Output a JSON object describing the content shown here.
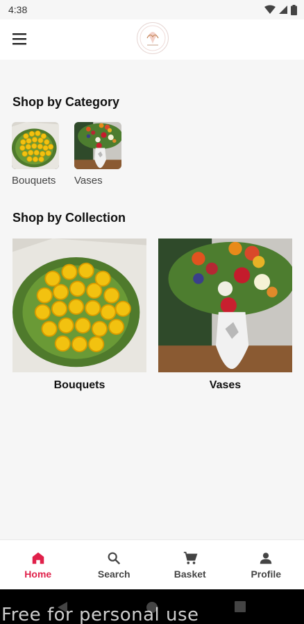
{
  "status_bar": {
    "time": "4:38"
  },
  "sections": {
    "category_title": "Shop by Category",
    "collection_title": "Shop by Collection"
  },
  "categories": [
    {
      "label": "Bouquets"
    },
    {
      "label": "Vases"
    }
  ],
  "collections": [
    {
      "label": "Bouquets"
    },
    {
      "label": "Vases"
    }
  ],
  "bottom_nav": {
    "items": [
      {
        "label": "Home",
        "icon": "home-icon",
        "active": true
      },
      {
        "label": "Search",
        "icon": "search-icon",
        "active": false
      },
      {
        "label": "Basket",
        "icon": "cart-icon",
        "active": false
      },
      {
        "label": "Profile",
        "icon": "person-icon",
        "active": false
      }
    ],
    "active_color": "#e0204a"
  },
  "watermark": "Free for personal use"
}
